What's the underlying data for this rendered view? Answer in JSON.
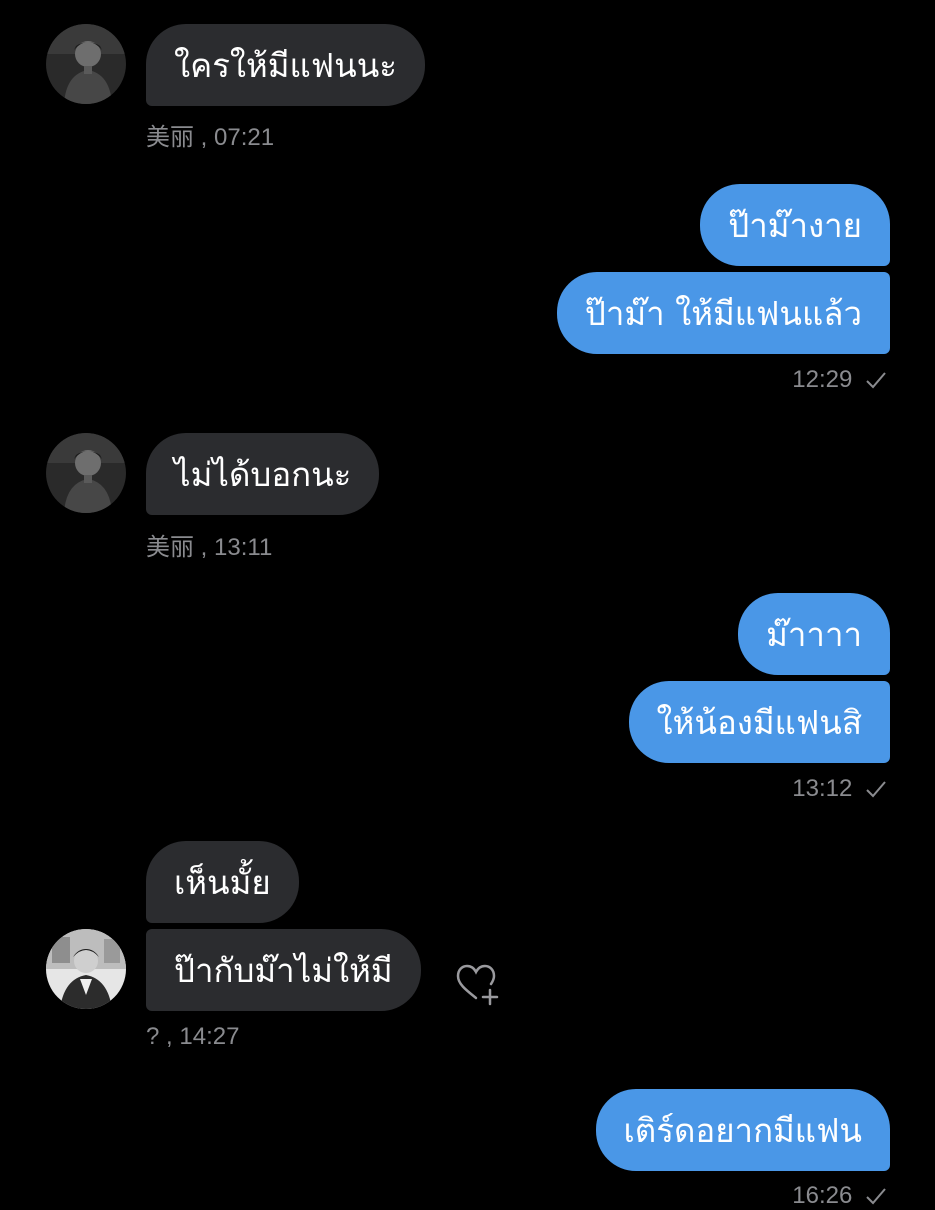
{
  "colors": {
    "background": "#000000",
    "incoming_bubble": "#2b2c2f",
    "outgoing_bubble": "#4a97e7",
    "meta_text": "#8a8b8f"
  },
  "messages": [
    {
      "direction": "incoming",
      "bubbles": [
        "ใครให้มีแฟนนะ"
      ],
      "sender": "美丽",
      "time": ", 07:21",
      "avatar": "avatar-1"
    },
    {
      "direction": "outgoing",
      "bubbles": [
        "ป๊าม๊างาย",
        "ป๊าม๊า ให้มีแฟนแล้ว"
      ],
      "time": "12:29",
      "status_icon": "check-icon"
    },
    {
      "direction": "incoming",
      "bubbles": [
        "ไม่ได้บอกนะ"
      ],
      "sender": "美丽",
      "time": ", 13:11",
      "avatar": "avatar-1"
    },
    {
      "direction": "outgoing",
      "bubbles": [
        "ม๊าาาา",
        "ให้น้องมีแฟนสิ"
      ],
      "time": "13:12",
      "status_icon": "check-icon"
    },
    {
      "direction": "incoming",
      "bubbles": [
        "เห็นมั้ย",
        "ป๊ากับม๊าไม่ให้มี"
      ],
      "sender": "?",
      "time": ", 14:27",
      "avatar": "avatar-2",
      "reaction_icon": "heart-plus-icon"
    },
    {
      "direction": "outgoing",
      "bubbles": [
        "เติร์ดอยากมีแฟน"
      ],
      "time": "16:26",
      "status_icon": "check-icon"
    }
  ]
}
